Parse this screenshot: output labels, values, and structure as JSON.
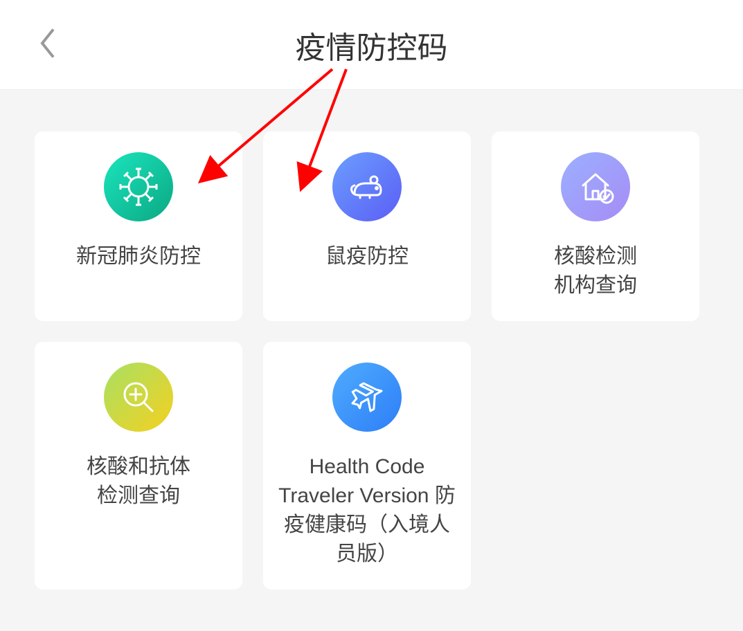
{
  "header": {
    "title": "疫情防控码"
  },
  "cards": [
    {
      "label": "新冠肺炎防控",
      "icon": "virus"
    },
    {
      "label": "鼠疫防控",
      "icon": "mouse"
    },
    {
      "label": "核酸检测\n机构查询",
      "icon": "house"
    },
    {
      "label": "核酸和抗体\n检测查询",
      "icon": "plus"
    },
    {
      "label": "Health Code Traveler Version 防疫健康码（入境人员版）",
      "icon": "plane"
    }
  ],
  "annotations": {
    "arrow_color": "#ff0000"
  }
}
